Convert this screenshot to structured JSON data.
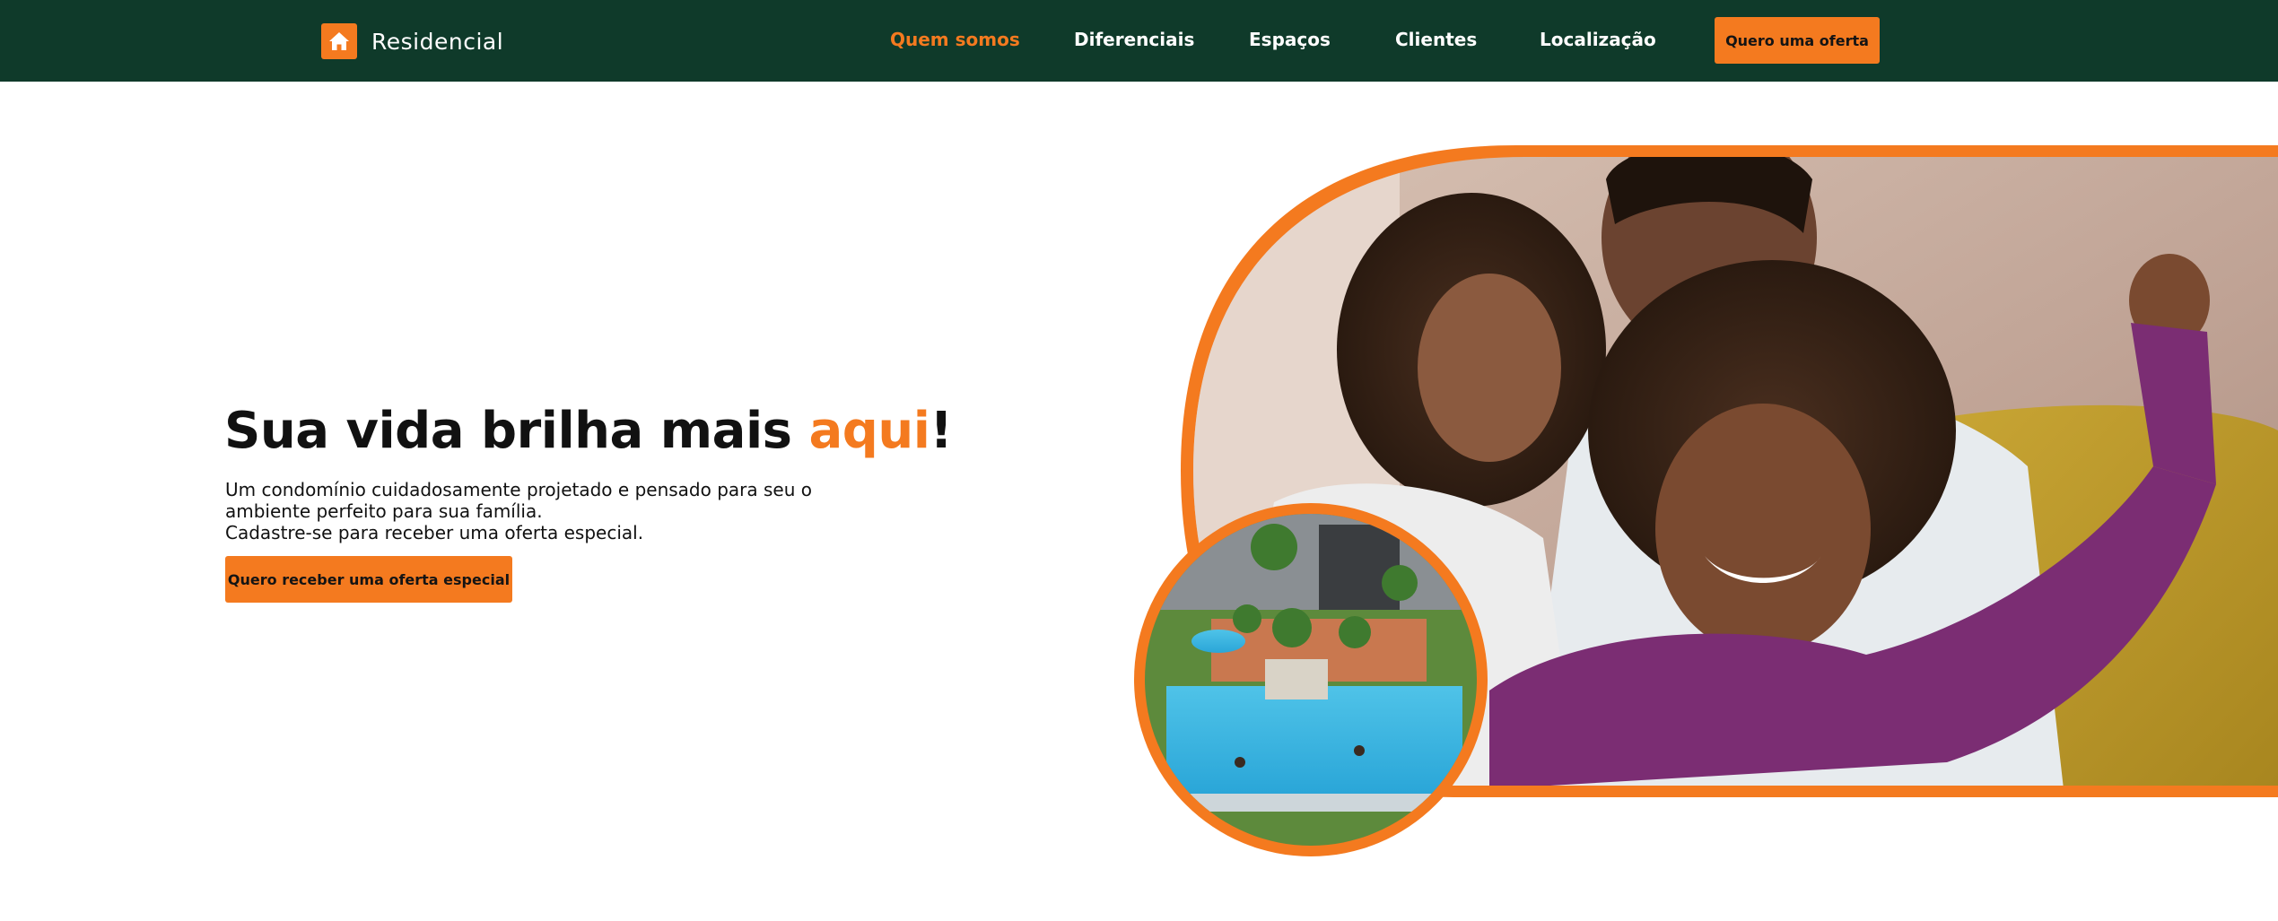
{
  "header": {
    "brand": "Residencial",
    "nav": [
      {
        "label": "Quem somos",
        "active": true
      },
      {
        "label": "Diferenciais",
        "active": false
      },
      {
        "label": "Espaços",
        "active": false
      },
      {
        "label": "Clientes",
        "active": false
      },
      {
        "label": "Localização",
        "active": false
      }
    ],
    "cta": "Quero uma oferta",
    "brand_icon": "home-icon"
  },
  "hero": {
    "title_start": "Sua vida brilha mais ",
    "title_accent": "aqui",
    "title_end": "!",
    "description_line1": "Um condomínio cuidadosamente projetado e pensado para seu o ambiente perfeito para sua família.",
    "description_line2": "Cadastre-se para receber uma oferta especial.",
    "cta": "Quero receber uma oferta especial",
    "main_image": "family-photo",
    "inset_image": "pool-aerial-photo"
  },
  "colors": {
    "nav_bg": "#0f3a2a",
    "accent": "#f47a1f",
    "text": "#111111"
  }
}
